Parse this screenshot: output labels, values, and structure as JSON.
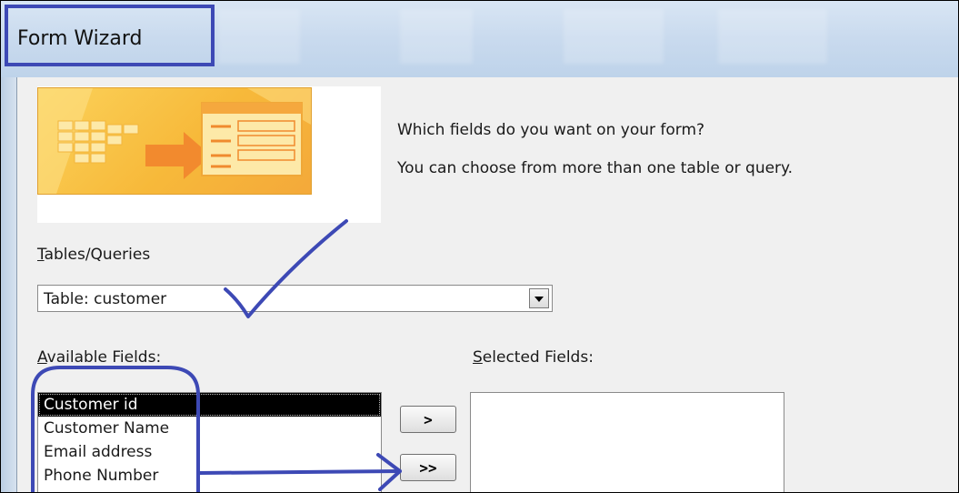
{
  "window": {
    "title": "Form Wizard"
  },
  "wizard": {
    "question": "Which fields do you want on your form?",
    "hint": "You can choose from more than one table or query."
  },
  "tables_queries": {
    "label_accel": "T",
    "label_rest": "ables/Queries",
    "selected_value": "Table: customer"
  },
  "available_fields": {
    "label_accel": "A",
    "label_rest": "vailable Fields:",
    "items": [
      {
        "label": "Customer id",
        "selected": true
      },
      {
        "label": "Customer Name",
        "selected": false
      },
      {
        "label": "Email address",
        "selected": false
      },
      {
        "label": "Phone Number",
        "selected": false
      }
    ]
  },
  "selected_fields": {
    "label_accel": "S",
    "label_rest": "elected Fields:",
    "items": []
  },
  "buttons": {
    "add_one": ">",
    "add_all": ">>"
  },
  "colors": {
    "annotation": "#3d49b5",
    "titlebar": "#c9daee",
    "dialog_bg": "#f0f0f0",
    "hero_orange": "#f7b93a"
  },
  "icons": {
    "hero": "form-wizard-illustration",
    "dropdown": "chevron-down-icon"
  }
}
